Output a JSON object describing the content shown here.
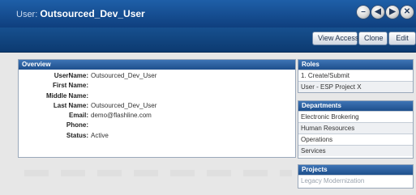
{
  "window": {
    "title_prefix": "User:",
    "title_user": "Outsourced_Dev_User",
    "buttons": [
      {
        "icon": "minimize-icon",
        "glyph": "–"
      },
      {
        "icon": "back-icon",
        "glyph": "◀"
      },
      {
        "icon": "forward-icon",
        "glyph": "▶"
      },
      {
        "icon": "close-icon",
        "glyph": "✕"
      }
    ]
  },
  "toolbar": {
    "view_access_label": "View Access",
    "clone_label": "Clone",
    "edit_label": "Edit"
  },
  "overview": {
    "header": "Overview",
    "fields": [
      {
        "label": "UserName:",
        "value": "Outsourced_Dev_User"
      },
      {
        "label": "First Name:",
        "value": ""
      },
      {
        "label": "Middle Name:",
        "value": ""
      },
      {
        "label": "Last Name:",
        "value": "Outsourced_Dev_User"
      },
      {
        "label": "Email:",
        "value": "demo@flashline.com"
      },
      {
        "label": "Phone:",
        "value": ""
      },
      {
        "label": "Status:",
        "value": "Active"
      }
    ]
  },
  "roles": {
    "header": "Roles",
    "items": [
      "1. Create/Submit",
      "User - ESP Project X"
    ]
  },
  "departments": {
    "header": "Departments",
    "items": [
      "Electronic Brokering",
      "Human Resources",
      "Operations",
      "Services"
    ]
  },
  "projects": {
    "header": "Projects",
    "items": [
      "Legacy Modernization"
    ]
  },
  "colors": {
    "header_blue": "#1e5fa8",
    "panel_header": "#2a5f9e",
    "background": "#e7e7e7"
  }
}
